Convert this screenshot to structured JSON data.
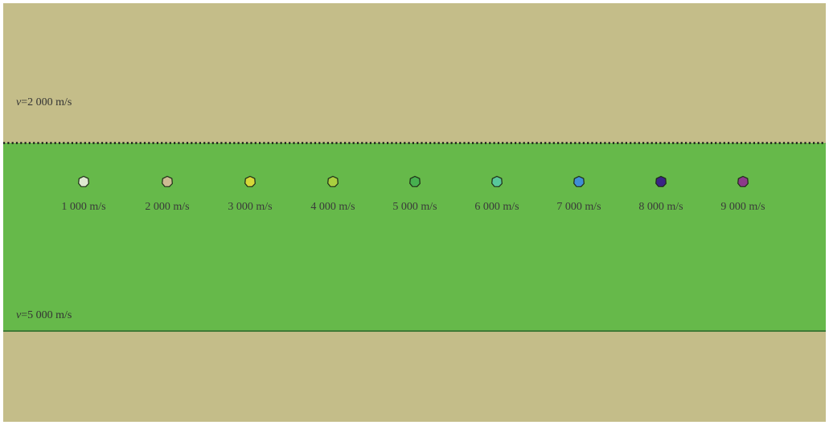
{
  "layers": {
    "top": {
      "velocity_symbol": "v",
      "velocity_value": "=2 000 m/s",
      "color": "#c4bd89"
    },
    "middle": {
      "velocity_symbol": "v",
      "velocity_value": "=5 000 m/s",
      "color": "#66b94a"
    },
    "bottom": {
      "color": "#c4bd89"
    }
  },
  "markers": [
    {
      "label": "1 000 m/s",
      "color": "#dde9d1"
    },
    {
      "label": "2 000 m/s",
      "color": "#cdbb93"
    },
    {
      "label": "3 000 m/s",
      "color": "#d6d83a"
    },
    {
      "label": "4 000 m/s",
      "color": "#a9cf3f"
    },
    {
      "label": "5 000 m/s",
      "color": "#47b04f"
    },
    {
      "label": "6 000 m/s",
      "color": "#58c79a"
    },
    {
      "label": "7 000 m/s",
      "color": "#3f8ed6"
    },
    {
      "label": "8 000 m/s",
      "color": "#3a2485"
    },
    {
      "label": "9 000 m/s",
      "color": "#8c3b8a"
    }
  ]
}
